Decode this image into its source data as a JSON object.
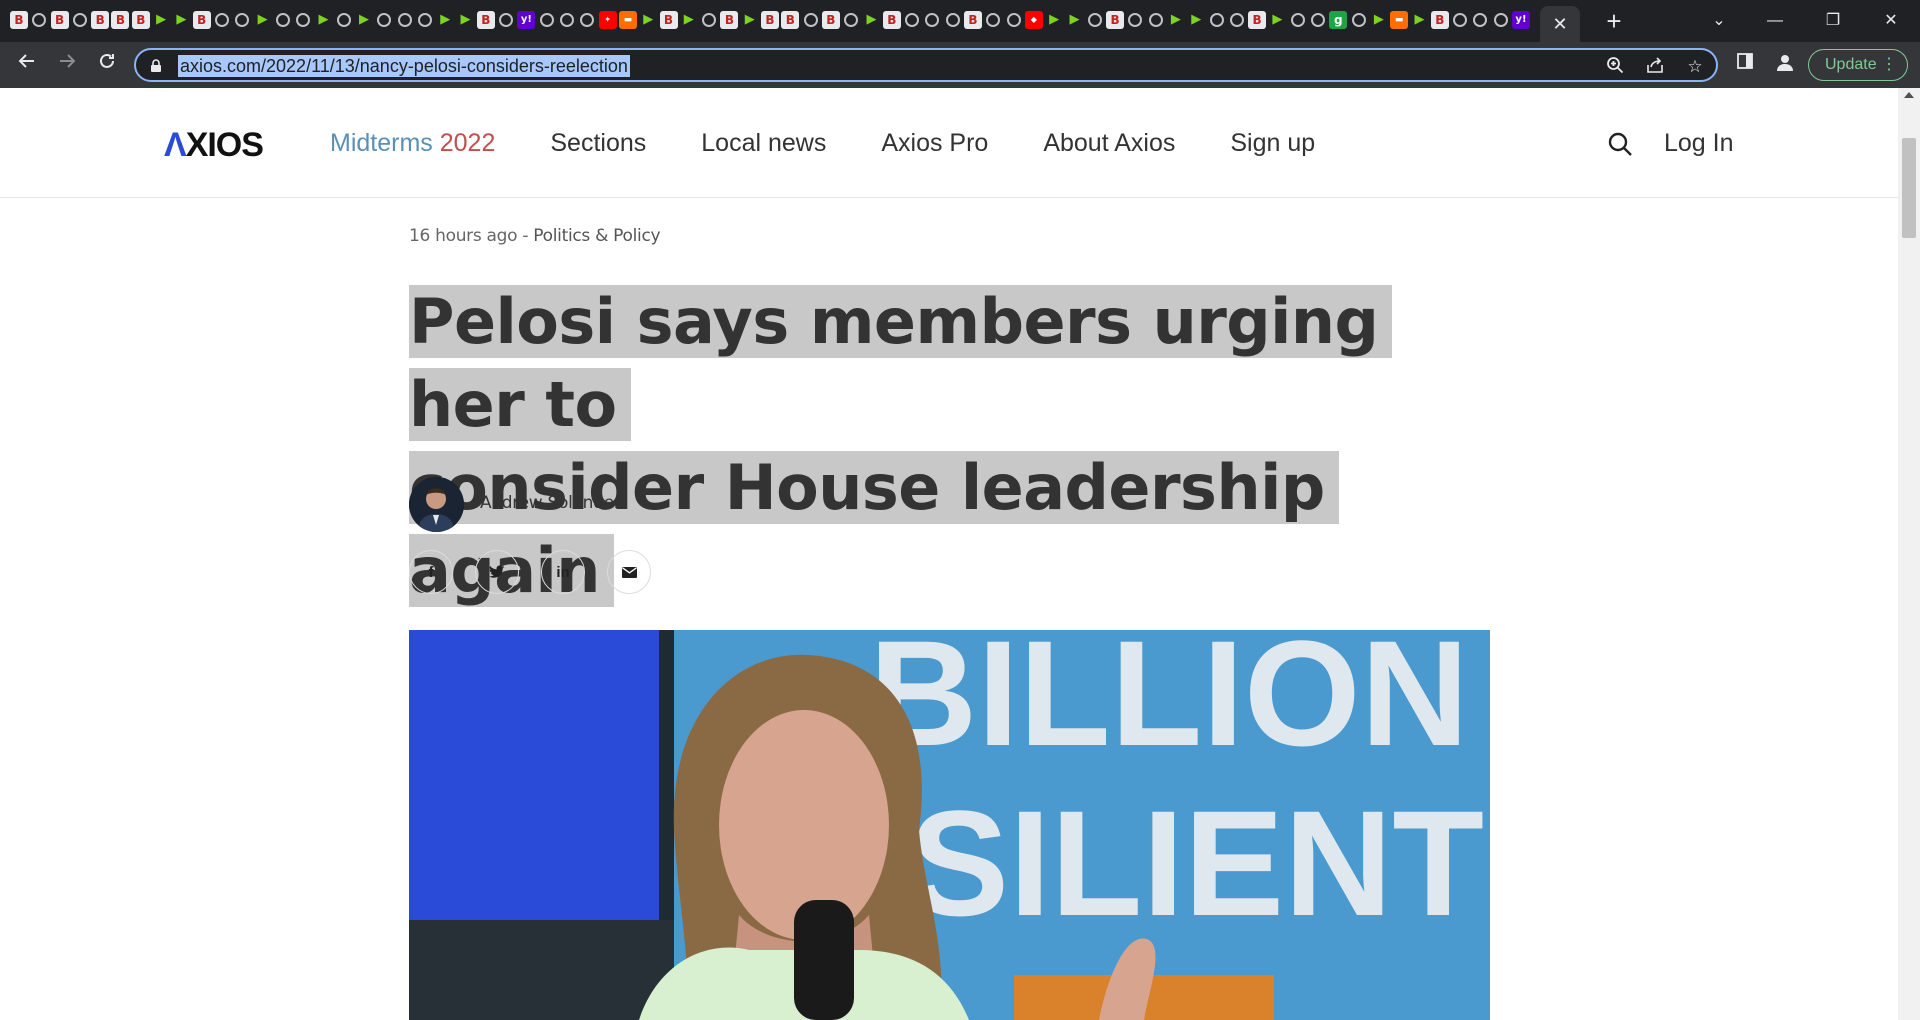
{
  "browser": {
    "tab_favicons": [
      "B",
      "G",
      "B",
      "G",
      "B",
      "B",
      "B",
      "▶",
      "▶",
      "B",
      "G",
      "G",
      "▶",
      "G",
      "G",
      "▶",
      "G",
      "▶",
      "G",
      "G",
      "G",
      "▶",
      "▶",
      "B",
      "G",
      "Y",
      "G",
      "G",
      "G",
      "✦",
      "▬",
      "▶",
      "B",
      "▶",
      "G",
      "B",
      "▶",
      "B",
      "B",
      "G",
      "B",
      "G",
      "▶",
      "B",
      "G",
      "G",
      "G",
      "B",
      "G",
      "G",
      "◆",
      "▶",
      "▶",
      "G",
      "B",
      "G",
      "G",
      "▶",
      "▶",
      "G",
      "G",
      "B",
      "▶",
      "G",
      "G",
      "g",
      "G",
      "▶",
      "▬",
      "▶",
      "B",
      "G",
      "G",
      "G",
      "Y"
    ],
    "active_tab_close": "✕",
    "new_tab": "+",
    "url": "axios.com/2022/11/13/nancy-pelosi-considers-reelection",
    "update_label": "Update",
    "accent_color": "#8ab4f8"
  },
  "site": {
    "logo": {
      "mark": "Λ",
      "rest": "XIOS"
    },
    "nav": {
      "midterms": "Midterms",
      "midterms_year": "2022",
      "sections": "Sections",
      "local_news": "Local news",
      "axios_pro": "Axios Pro",
      "about": "About Axios",
      "signup": "Sign up"
    },
    "login": "Log In"
  },
  "article": {
    "time": "16 hours ago",
    "separator": " - ",
    "section": "Politics & Policy",
    "headline_line1": "Pelosi says members urging her to",
    "headline_line2": "consider House leadership again",
    "author": "Andrew Solender",
    "share": {
      "facebook": "f",
      "twitter": "🐦",
      "linkedin": "in",
      "email": "✉"
    },
    "hero_text_line1": "BILLION",
    "hero_text_line2": "SILIENT"
  }
}
